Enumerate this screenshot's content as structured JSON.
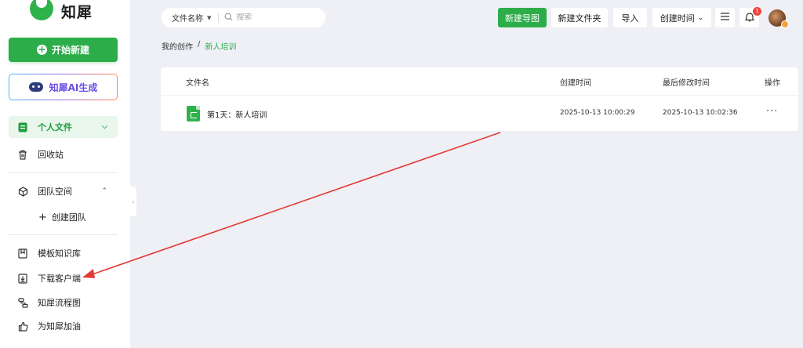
{
  "app": {
    "name": "知犀"
  },
  "sidebar": {
    "new_button": "开始新建",
    "ai_button": "知犀AI生成",
    "items": [
      {
        "label": "个人文件",
        "icon": "doc-icon",
        "active": true
      },
      {
        "label": "回收站",
        "icon": "trash-icon"
      },
      {
        "label": "团队空间",
        "icon": "cube-icon"
      },
      {
        "label": "创建团队",
        "icon": "plus-icon"
      },
      {
        "label": "模板知识库",
        "icon": "bookmark-icon"
      },
      {
        "label": "下载客户端",
        "icon": "download-icon"
      },
      {
        "label": "知犀流程图",
        "icon": "flowchart-icon"
      },
      {
        "label": "为知犀加油",
        "icon": "thumbs-up-icon"
      }
    ]
  },
  "search": {
    "field_select": "文件名称",
    "placeholder": "搜索"
  },
  "toolbar": {
    "new_map": "新建导图",
    "new_folder": "新建文件夹",
    "import": "导入",
    "sort": "创建时间",
    "notification_count": "1"
  },
  "breadcrumb": {
    "root": "我的创作",
    "separator": "/",
    "current": "新人培训"
  },
  "table": {
    "columns": [
      "文件名",
      "创建时间",
      "最后修改时间",
      "操作"
    ],
    "rows": [
      {
        "name": "第1天：新人培训",
        "created": "2025-10-13 10:00:29",
        "modified": "2025-10-13 10:02:36",
        "action": "···"
      }
    ]
  },
  "colors": {
    "brand": "#2cad4a",
    "annotation_arrow": "#e53935",
    "badge": "#f0443a"
  }
}
